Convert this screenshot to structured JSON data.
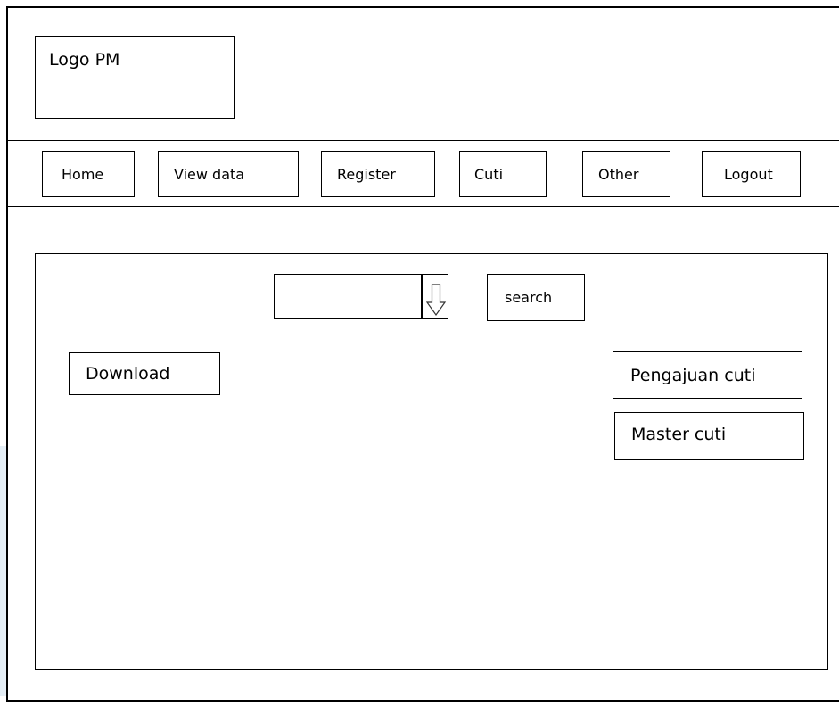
{
  "header": {
    "logo_label": "Logo PM"
  },
  "nav": {
    "items": [
      {
        "label": "Home"
      },
      {
        "label": "View data"
      },
      {
        "label": "Register"
      },
      {
        "label": "Cuti"
      },
      {
        "label": "Other"
      },
      {
        "label": "Logout"
      }
    ]
  },
  "main": {
    "search": {
      "value": "",
      "button_label": "search"
    },
    "download_label": "Download",
    "pengajuan_cuti_label": "Pengajuan cuti",
    "master_cuti_label": "Master cuti"
  },
  "icons": {
    "dropdown": "down-arrow-icon"
  }
}
